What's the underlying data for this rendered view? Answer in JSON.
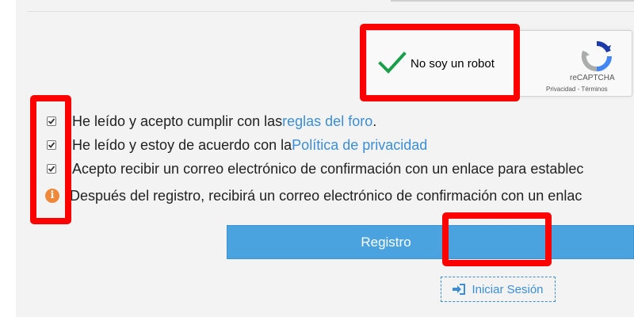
{
  "recaptcha": {
    "label": "No soy un robot",
    "brand": "reCAPTCHA",
    "privacy_link": "Privacidad",
    "separator": " - ",
    "terms_link": "Términos",
    "checked": true
  },
  "agreements": [
    {
      "prefix": "He leído y acepto cumplir con las ",
      "link": "reglas del foro",
      "suffix": ".",
      "checked": true
    },
    {
      "prefix": "He leído y estoy de acuerdo con la ",
      "link": "Política de privacidad",
      "suffix": "",
      "checked": true
    },
    {
      "prefix": "Acepto recibir un correo electrónico de confirmación con un enlace para establec",
      "link": "",
      "suffix": "",
      "checked": true
    }
  ],
  "info_notice": {
    "icon": "info-icon",
    "text": "Después del registro, recibirá un correo electrónico de confirmación con un enlac"
  },
  "buttons": {
    "register_label": "Registro",
    "login_label": "Iniciar Sesión",
    "login_icon": "sign-in-icon"
  },
  "colors": {
    "accent": "#4aa3df",
    "link": "#3b8ed6",
    "check_green": "#1a9e4a",
    "info_orange": "#f0883a",
    "highlight_red": "#ff0000"
  }
}
